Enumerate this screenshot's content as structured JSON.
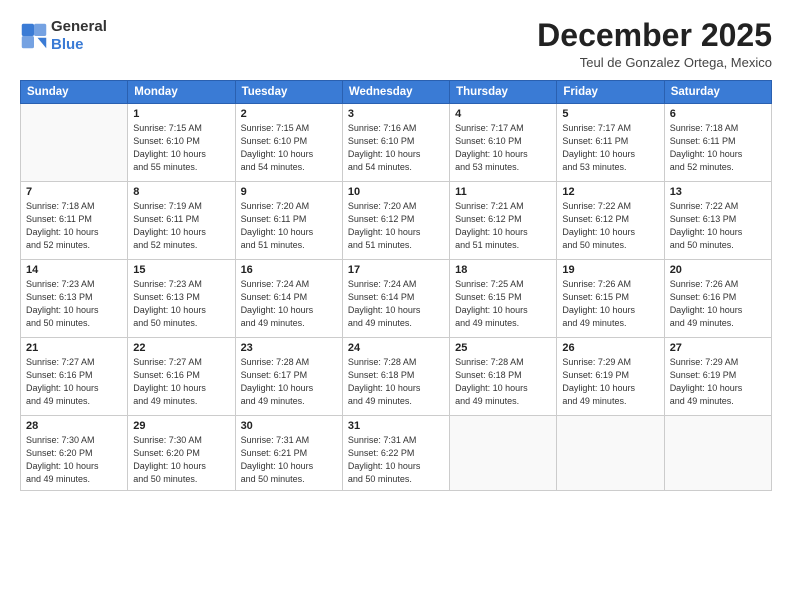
{
  "logo": {
    "line1": "General",
    "line2": "Blue"
  },
  "header": {
    "month": "December 2025",
    "location": "Teul de Gonzalez Ortega, Mexico"
  },
  "weekdays": [
    "Sunday",
    "Monday",
    "Tuesday",
    "Wednesday",
    "Thursday",
    "Friday",
    "Saturday"
  ],
  "weeks": [
    [
      {
        "day": "",
        "info": ""
      },
      {
        "day": "1",
        "info": "Sunrise: 7:15 AM\nSunset: 6:10 PM\nDaylight: 10 hours\nand 55 minutes."
      },
      {
        "day": "2",
        "info": "Sunrise: 7:15 AM\nSunset: 6:10 PM\nDaylight: 10 hours\nand 54 minutes."
      },
      {
        "day": "3",
        "info": "Sunrise: 7:16 AM\nSunset: 6:10 PM\nDaylight: 10 hours\nand 54 minutes."
      },
      {
        "day": "4",
        "info": "Sunrise: 7:17 AM\nSunset: 6:10 PM\nDaylight: 10 hours\nand 53 minutes."
      },
      {
        "day": "5",
        "info": "Sunrise: 7:17 AM\nSunset: 6:11 PM\nDaylight: 10 hours\nand 53 minutes."
      },
      {
        "day": "6",
        "info": "Sunrise: 7:18 AM\nSunset: 6:11 PM\nDaylight: 10 hours\nand 52 minutes."
      }
    ],
    [
      {
        "day": "7",
        "info": "Sunrise: 7:18 AM\nSunset: 6:11 PM\nDaylight: 10 hours\nand 52 minutes."
      },
      {
        "day": "8",
        "info": "Sunrise: 7:19 AM\nSunset: 6:11 PM\nDaylight: 10 hours\nand 52 minutes."
      },
      {
        "day": "9",
        "info": "Sunrise: 7:20 AM\nSunset: 6:11 PM\nDaylight: 10 hours\nand 51 minutes."
      },
      {
        "day": "10",
        "info": "Sunrise: 7:20 AM\nSunset: 6:12 PM\nDaylight: 10 hours\nand 51 minutes."
      },
      {
        "day": "11",
        "info": "Sunrise: 7:21 AM\nSunset: 6:12 PM\nDaylight: 10 hours\nand 51 minutes."
      },
      {
        "day": "12",
        "info": "Sunrise: 7:22 AM\nSunset: 6:12 PM\nDaylight: 10 hours\nand 50 minutes."
      },
      {
        "day": "13",
        "info": "Sunrise: 7:22 AM\nSunset: 6:13 PM\nDaylight: 10 hours\nand 50 minutes."
      }
    ],
    [
      {
        "day": "14",
        "info": "Sunrise: 7:23 AM\nSunset: 6:13 PM\nDaylight: 10 hours\nand 50 minutes."
      },
      {
        "day": "15",
        "info": "Sunrise: 7:23 AM\nSunset: 6:13 PM\nDaylight: 10 hours\nand 50 minutes."
      },
      {
        "day": "16",
        "info": "Sunrise: 7:24 AM\nSunset: 6:14 PM\nDaylight: 10 hours\nand 49 minutes."
      },
      {
        "day": "17",
        "info": "Sunrise: 7:24 AM\nSunset: 6:14 PM\nDaylight: 10 hours\nand 49 minutes."
      },
      {
        "day": "18",
        "info": "Sunrise: 7:25 AM\nSunset: 6:15 PM\nDaylight: 10 hours\nand 49 minutes."
      },
      {
        "day": "19",
        "info": "Sunrise: 7:26 AM\nSunset: 6:15 PM\nDaylight: 10 hours\nand 49 minutes."
      },
      {
        "day": "20",
        "info": "Sunrise: 7:26 AM\nSunset: 6:16 PM\nDaylight: 10 hours\nand 49 minutes."
      }
    ],
    [
      {
        "day": "21",
        "info": "Sunrise: 7:27 AM\nSunset: 6:16 PM\nDaylight: 10 hours\nand 49 minutes."
      },
      {
        "day": "22",
        "info": "Sunrise: 7:27 AM\nSunset: 6:16 PM\nDaylight: 10 hours\nand 49 minutes."
      },
      {
        "day": "23",
        "info": "Sunrise: 7:28 AM\nSunset: 6:17 PM\nDaylight: 10 hours\nand 49 minutes."
      },
      {
        "day": "24",
        "info": "Sunrise: 7:28 AM\nSunset: 6:18 PM\nDaylight: 10 hours\nand 49 minutes."
      },
      {
        "day": "25",
        "info": "Sunrise: 7:28 AM\nSunset: 6:18 PM\nDaylight: 10 hours\nand 49 minutes."
      },
      {
        "day": "26",
        "info": "Sunrise: 7:29 AM\nSunset: 6:19 PM\nDaylight: 10 hours\nand 49 minutes."
      },
      {
        "day": "27",
        "info": "Sunrise: 7:29 AM\nSunset: 6:19 PM\nDaylight: 10 hours\nand 49 minutes."
      }
    ],
    [
      {
        "day": "28",
        "info": "Sunrise: 7:30 AM\nSunset: 6:20 PM\nDaylight: 10 hours\nand 49 minutes."
      },
      {
        "day": "29",
        "info": "Sunrise: 7:30 AM\nSunset: 6:20 PM\nDaylight: 10 hours\nand 50 minutes."
      },
      {
        "day": "30",
        "info": "Sunrise: 7:31 AM\nSunset: 6:21 PM\nDaylight: 10 hours\nand 50 minutes."
      },
      {
        "day": "31",
        "info": "Sunrise: 7:31 AM\nSunset: 6:22 PM\nDaylight: 10 hours\nand 50 minutes."
      },
      {
        "day": "",
        "info": ""
      },
      {
        "day": "",
        "info": ""
      },
      {
        "day": "",
        "info": ""
      }
    ]
  ]
}
